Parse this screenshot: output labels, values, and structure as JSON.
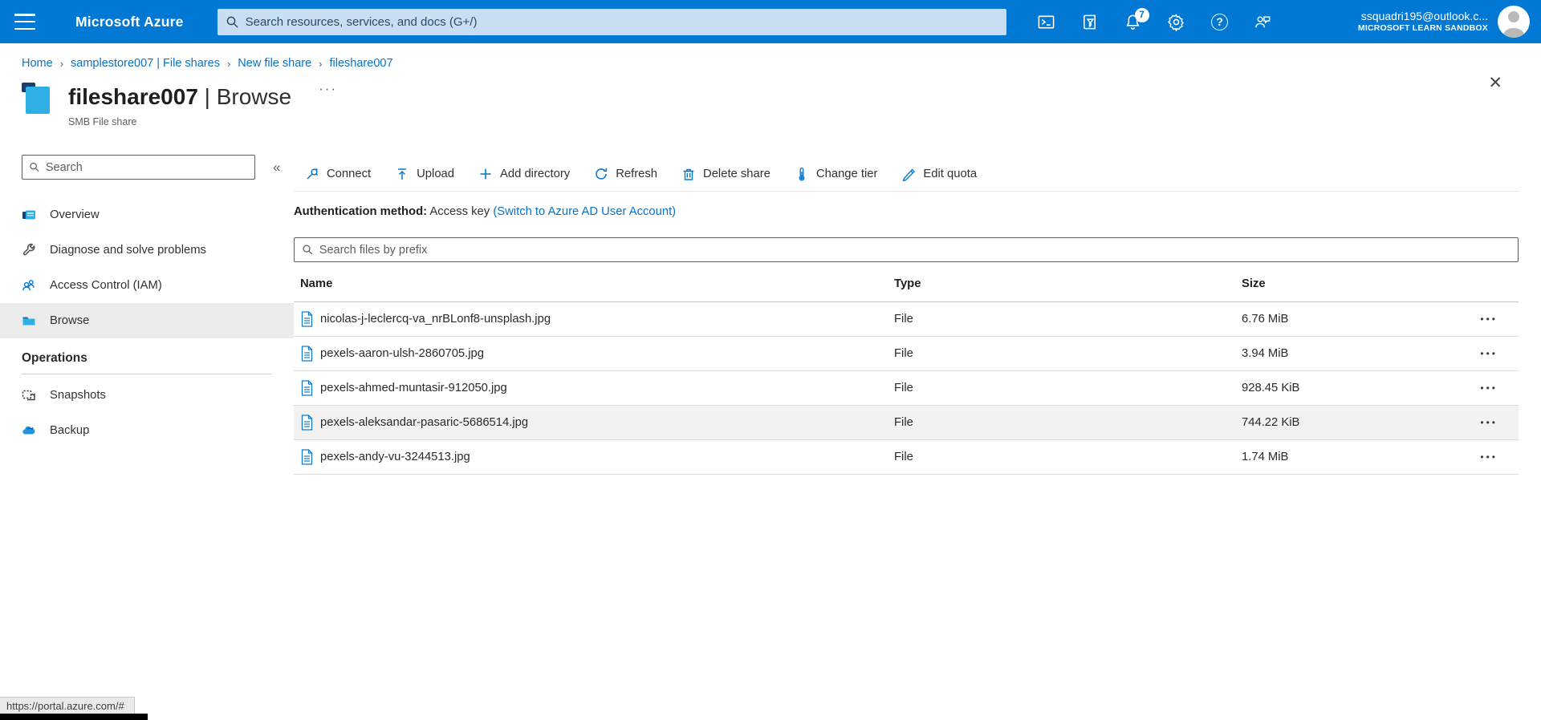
{
  "header": {
    "brand": "Microsoft Azure",
    "search_placeholder": "Search resources, services, and docs (G+/)",
    "notification_count": "7",
    "help_glyph": "?",
    "account": {
      "email": "ssquadri195@outlook.c...",
      "tenant": "MICROSOFT LEARN SANDBOX"
    }
  },
  "breadcrumb": {
    "separator": "›",
    "items": [
      "Home",
      "samplestore007 | File shares",
      "New file share",
      "fileshare007"
    ]
  },
  "page": {
    "title": "fileshare007",
    "title_suffix": "| Browse",
    "subtitle": "SMB File share",
    "more_glyph": "···",
    "close_glyph": "✕"
  },
  "sidebar": {
    "search_placeholder": "Search",
    "collapse_glyph": "«",
    "items": [
      {
        "label": "Overview",
        "icon": "overview-icon"
      },
      {
        "label": "Diagnose and solve problems",
        "icon": "wrench-icon"
      },
      {
        "label": "Access Control (IAM)",
        "icon": "people-icon"
      },
      {
        "label": "Browse",
        "icon": "folder-icon",
        "selected": true
      }
    ],
    "section_title": "Operations",
    "operations_items": [
      {
        "label": "Snapshots",
        "icon": "snapshot-icon"
      },
      {
        "label": "Backup",
        "icon": "backup-cloud-icon"
      }
    ]
  },
  "toolbar": {
    "buttons": [
      "Connect",
      "Upload",
      "Add directory",
      "Refresh",
      "Delete share",
      "Change tier",
      "Edit quota"
    ]
  },
  "auth": {
    "label": "Authentication method:",
    "value": "Access key",
    "link": "(Switch to Azure AD User Account)"
  },
  "files": {
    "search_placeholder": "Search files by prefix",
    "columns": [
      "Name",
      "Type",
      "Size"
    ],
    "row_menu_glyph": "•••",
    "rows": [
      {
        "name": "nicolas-j-leclercq-va_nrBLonf8-unsplash.jpg",
        "type": "File",
        "size": "6.76 MiB"
      },
      {
        "name": "pexels-aaron-ulsh-2860705.jpg",
        "type": "File",
        "size": "3.94 MiB"
      },
      {
        "name": "pexels-ahmed-muntasir-912050.jpg",
        "type": "File",
        "size": "928.45 KiB"
      },
      {
        "name": "pexels-aleksandar-pasaric-5686514.jpg",
        "type": "File",
        "size": "744.22 KiB",
        "highlighted": true
      },
      {
        "name": "pexels-andy-vu-3244513.jpg",
        "type": "File",
        "size": "1.74 MiB"
      }
    ]
  },
  "statusbar": {
    "url": "https://portal.azure.com/#"
  },
  "colors": {
    "header_bg": "#0078d4",
    "accent": "#0078d4",
    "link": "#0a72c7",
    "fileshare_cyan": "#2fb0e4",
    "selected_item_bg": "#ececec",
    "row_highlight_bg": "#f3f2f1"
  }
}
